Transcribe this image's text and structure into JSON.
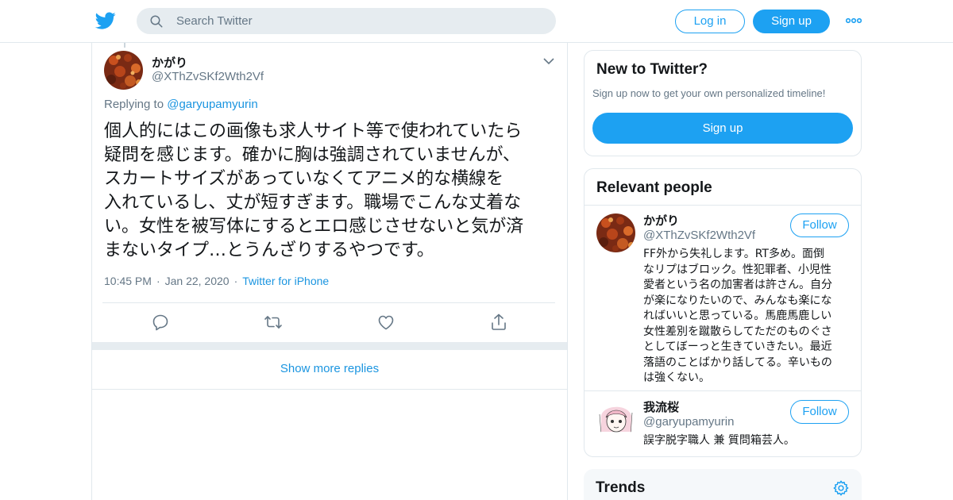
{
  "header": {
    "search_placeholder": "Search Twitter",
    "login_label": "Log in",
    "signup_label": "Sign up",
    "icons": [
      "twitter-bird-icon",
      "search-icon",
      "more-dots-icon"
    ]
  },
  "tweet": {
    "author_name": "かがり",
    "author_handle": "@XThZvSKf2Wth2Vf",
    "replying_prefix": "Replying to",
    "replying_to": "@garyupamyurin",
    "text": "個人的にはこの画像も求人サイト等で使われていたら\n疑問を感じます。確かに胸は強調されていませんが、\nスカートサイズがあっていなくてアニメ的な横線を\n入れているし、丈が短すぎます。職場でこんな丈着な\nい。女性を被写体にするとエロ感じさせないと気が済\nまないタイプ…とうんざりするやつです。",
    "time": "10:45 PM",
    "date": "Jan 22, 2020",
    "source": "Twitter for iPhone",
    "actions": [
      "reply-icon",
      "retweet-icon",
      "like-icon",
      "share-icon"
    ]
  },
  "thread": {
    "show_more": "Show more replies"
  },
  "sidebar": {
    "new_title": "New to Twitter?",
    "new_subtitle": "Sign up now to get your own personalized timeline!",
    "signup_label": "Sign up",
    "relevant_title": "Relevant people",
    "people": [
      {
        "name": "かがり",
        "handle": "@XThZvSKf2Wth2Vf",
        "follow_label": "Follow",
        "bio": "FF外から失礼します。RT多め。面倒\nなリプはブロック。性犯罪者、小児性\n愛者という名の加害者は許さん。自分\nが楽になりたいので、みんなも楽にな\nればいいと思っている。馬鹿馬鹿しい\n女性差別を蹴散らしてただのものぐさ\nとしてぼーっと生きていきたい。最近\n落語のことばかり話してる。辛いもの\nは強くない。"
      },
      {
        "name": "我流桜",
        "handle": "@garyupamyurin",
        "follow_label": "Follow",
        "bio": "誤字脱字職人 兼 質問箱芸人。"
      }
    ],
    "trends_title": "Trends"
  },
  "colors": {
    "accent": "#1da1f2",
    "link": "#1b95e0",
    "secondary_text": "#657786",
    "border": "#e1e8ed"
  }
}
